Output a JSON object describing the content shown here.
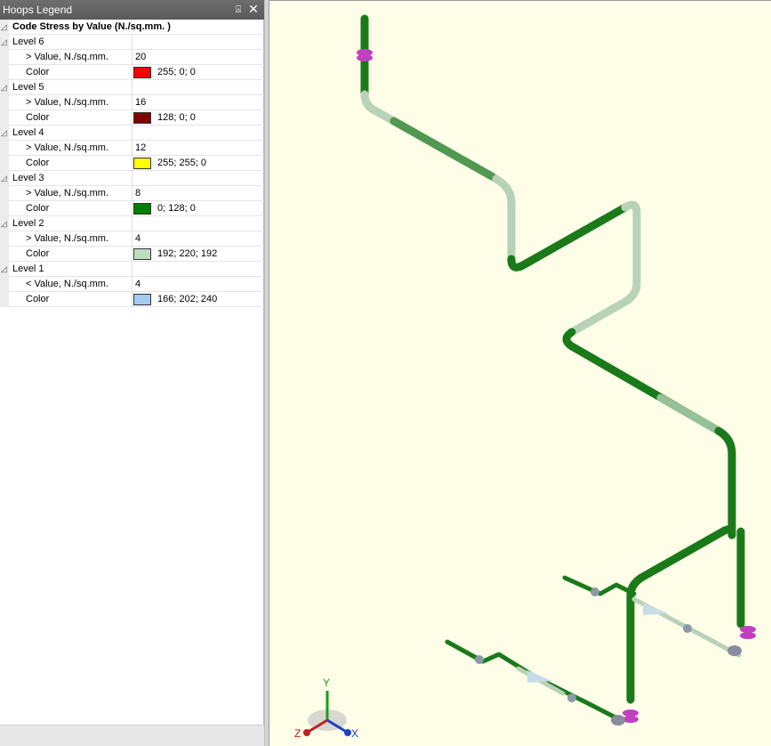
{
  "pane": {
    "title": "Hoops Legend",
    "pin_glyph": "⍓",
    "close_glyph": "✕"
  },
  "legend": {
    "category": "Code Stress by Value (N./sq.mm. )",
    "levels": [
      {
        "label": "Level 6",
        "value_label": "> Value, N./sq.mm.",
        "value": "20",
        "color_label": "Color",
        "color_text": "255; 0; 0",
        "color_hex": "#ff0000"
      },
      {
        "label": "Level 5",
        "value_label": "> Value, N./sq.mm.",
        "value": "16",
        "color_label": "Color",
        "color_text": "128; 0; 0",
        "color_hex": "#800000"
      },
      {
        "label": "Level 4",
        "value_label": "> Value, N./sq.mm.",
        "value": "12",
        "color_label": "Color",
        "color_text": "255; 255; 0",
        "color_hex": "#ffff00"
      },
      {
        "label": "Level 3",
        "value_label": "> Value, N./sq.mm.",
        "value": "8",
        "color_label": "Color",
        "color_text": "0; 128; 0",
        "color_hex": "#008000"
      },
      {
        "label": "Level 2",
        "value_label": "> Value, N./sq.mm.",
        "value": "4",
        "color_label": "Color",
        "color_text": "192; 220; 192",
        "color_hex": "#c0dcc0"
      },
      {
        "label": "Level 1",
        "value_label": "< Value, N./sq.mm.",
        "value": "4",
        "color_label": "Color",
        "color_text": "166; 202; 240",
        "color_hex": "#a6caf0"
      }
    ]
  },
  "axis_triad": {
    "y": "Y",
    "z": "Z",
    "x": "X"
  },
  "colors": {
    "viewport_bg": "#fefde8",
    "pipe_green": "#1a7a1a",
    "pipe_light": "#b8d2b8",
    "flange_magenta": "#c040c0"
  }
}
